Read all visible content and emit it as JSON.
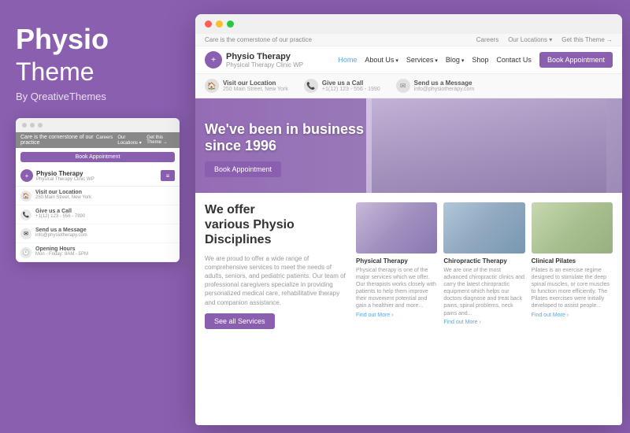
{
  "brand": {
    "physio": "Physio",
    "theme": "Theme",
    "by": "By QreativeThemes"
  },
  "mini_browser": {
    "tagline": "Care is the cornerstone of our practice",
    "nav_links": [
      "Careers",
      "Our Locations ▾",
      "Get this Theme →"
    ],
    "book_btn": "Book Appointment",
    "logo": {
      "name": "Physio Therapy",
      "sub": "Physical Therapy Clinic WP"
    },
    "info_items": [
      {
        "icon": "🏠",
        "label": "Visit our Location",
        "val": "250 Main Street, New York"
      },
      {
        "icon": "📞",
        "label": "Give us a Call",
        "val": "+1(12) 123 - 556 - 7890"
      },
      {
        "icon": "✉",
        "label": "Send us a Message",
        "val": "info@physiotherapy.com"
      },
      {
        "icon": "🕐",
        "label": "Opening Hours",
        "val": "Mon - Friday: 8AM - 5PM"
      }
    ]
  },
  "main_browser": {
    "utility_bar": {
      "tagline": "Care is the cornerstone of our practice",
      "links": [
        "Careers",
        "Our Locations ▾",
        "Get this Theme →"
      ]
    },
    "navbar": {
      "logo_name": "Physio Therapy",
      "logo_sub": "Physical Therapy Clinic WP",
      "links": [
        "Home",
        "About Us ▾",
        "Services ▾",
        "Blog ▾",
        "Shop",
        "Contact Us"
      ],
      "book_btn": "Book Appointment"
    },
    "info_bar": [
      {
        "icon": "🏠",
        "label": "Visit our Location",
        "val": "250 Main Street, New York"
      },
      {
        "icon": "📞",
        "label": "Give us a Call",
        "val": "+1(12) 123 - 556 - 1990"
      },
      {
        "icon": "✉",
        "label": "Send us a Message",
        "val": "info@physiotherapy.com"
      }
    ],
    "hero": {
      "line1": "We've been in business",
      "line2": "since 1996",
      "book_btn": "Book Appointment"
    },
    "services": {
      "heading_line1": "We offer",
      "heading_line2": "various Physio",
      "heading_line3": "Disciplines",
      "description": "We are proud to offer a wide range of comprehensive services to meet the needs of adults, seniors, and pediatric patients. Our team of professional caregivers specialize in providing personalized medical care, rehabilitative therapy and companion assistance.",
      "see_all_btn": "See all Services",
      "cards": [
        {
          "title": "Physical Therapy",
          "desc": "Physical therapy is one of the major services which we offer. Our therapists works closely with patients to help them improve their movement potential and gain a healthier and more...",
          "link": "Find out More ›"
        },
        {
          "title": "Chiropractic Therapy",
          "desc": "We are one of the most advanced chiropractic clinics and carry the latest chiropractic equipment which helps our doctors diagnose and treat back pains, spinal problems, neck pains and...",
          "link": "Find out More ›"
        },
        {
          "title": "Clinical Pilates",
          "desc": "Pilates is an exercise regime designed to stimulate the deep spinal muscles, or core muscles to function more efficiently. The Pilates exercises were initially developed to assist people...",
          "link": "Find out More ›"
        }
      ]
    }
  }
}
